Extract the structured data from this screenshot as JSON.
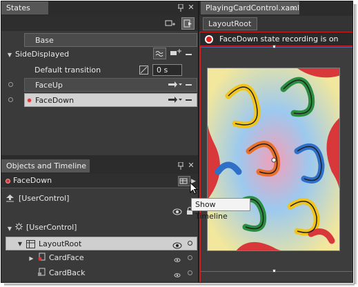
{
  "states_panel": {
    "title": "States",
    "base_label": "Base",
    "group_name": "SideDisplayed",
    "default_transition_label": "Default transition",
    "default_transition_value": "0 s",
    "states": [
      "FaceUp",
      "FaceDown"
    ]
  },
  "document": {
    "tab_title": "PlayingCardControl.xaml",
    "tab_close": "×",
    "breadcrumb": "LayoutRoot",
    "recording_text": "FaceDown state recording is on"
  },
  "objects_panel": {
    "title": "Objects and Timeline",
    "active_state": "FaceDown",
    "user_control_top": "[UserControl]",
    "user_control_tree": "[UserControl]",
    "layout_root": "LayoutRoot",
    "card_face": "CardFace",
    "card_back": "CardBack"
  },
  "tooltip": {
    "text": "Show Timeline"
  },
  "colors": {
    "recording_red": "#e21b1b",
    "panel_bg": "#3a3a3a",
    "selected_row": "#cccccc",
    "artboard_border": "#d21f1f"
  },
  "icons": [
    "pin-icon",
    "close-icon",
    "add-state-icon",
    "add-group-icon",
    "transition-icon",
    "remove-icon",
    "expand-icon",
    "collapse-icon",
    "eye-icon",
    "lock-icon",
    "timeline-icon",
    "record-icon",
    "cursor-icon"
  ]
}
